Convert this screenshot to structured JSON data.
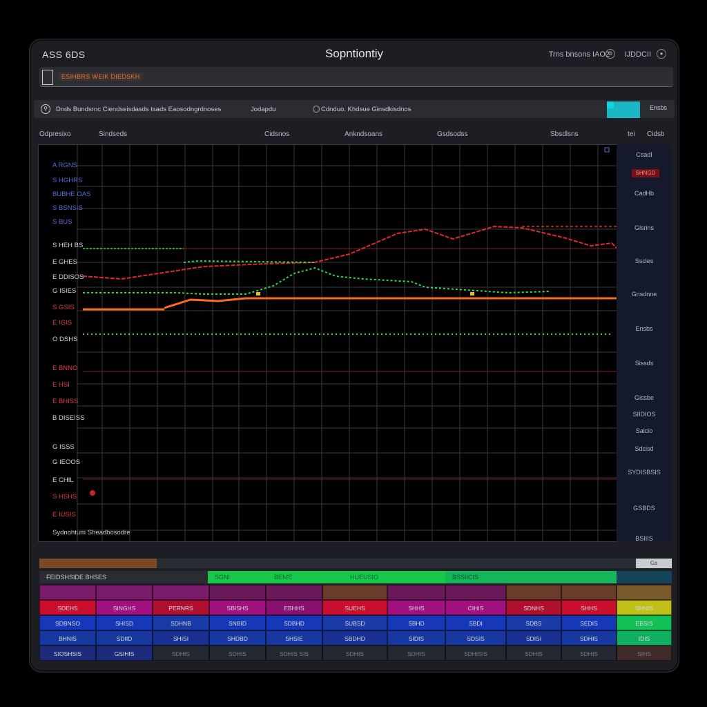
{
  "app": {
    "name": "ASS 6DS",
    "title": "Sopntiontiy"
  },
  "top_right": {
    "info": "Trns bnsons  IAO2",
    "user": "IJDDCII"
  },
  "alert": {
    "text": "ESIHBRS WEIK DIEDSKH",
    "color": "#e5703a"
  },
  "toolbar": {
    "left_text": "Dnds  Bundsrnc  Ciendseisdasds tsads  Eaosodngrdnoses",
    "mid_text": "Jodapdu",
    "radio_text": "Cdnduo.  Khdsue  Ginsdkisdnos",
    "end_label": "Ensbs"
  },
  "column_headers": [
    "Odpresixo",
    "Sindseds",
    "Cidsnos",
    "Ankndsoans",
    "Gsdsodss",
    "Sbsdlsns",
    "tei",
    "Cidsb"
  ],
  "chart": {
    "left_labels": [
      {
        "text": "A  RGNS",
        "color": "#5c6ad8"
      },
      {
        "text": "S HGHRS",
        "color": "#5c6ad8"
      },
      {
        "text": "BUBHE OAS",
        "color": "#5c6ad8"
      },
      {
        "text": "S BSNSIS",
        "color": "#5c6ad8"
      },
      {
        "text": "S BUS",
        "color": "#5c6ad8"
      },
      {
        "text": "S HEH BS",
        "color": "#d6d6dc"
      },
      {
        "text": "E GHES",
        "color": "#d6d6dc"
      },
      {
        "text": "E DDISOS",
        "color": "#d6d6dc"
      },
      {
        "text": "G ISIES",
        "color": "#d6d6dc"
      },
      {
        "text": "S GSIS",
        "color": "#d9434c"
      },
      {
        "text": "E IGIS",
        "color": "#d9434c"
      },
      {
        "text": "O DSHS",
        "color": "#d6d6dc"
      },
      {
        "text": "E BNNO",
        "color": "#e43b46"
      },
      {
        "text": "E HSI",
        "color": "#e43b46"
      },
      {
        "text": "E BHISS",
        "color": "#e43b46"
      },
      {
        "text": "B DISEISS",
        "color": "#d6d6dc"
      },
      {
        "text": "G ISSS",
        "color": "#d6d6dc"
      },
      {
        "text": "G IEOOS",
        "color": "#d6d6dc"
      },
      {
        "text": "E CHIL",
        "color": "#d6d6dc"
      },
      {
        "text": "S HSHS",
        "color": "#e43b46"
      },
      {
        "text": "E IUSIS",
        "color": "#e43b46"
      }
    ],
    "footer_label": "Sydnohtum  Sheadbosodre",
    "series": [
      {
        "color": "#e02a2a"
      },
      {
        "color": "#2fdc4a"
      },
      {
        "color": "#ff6a22"
      }
    ]
  },
  "right_panel": {
    "labels": [
      "CsadI",
      "CadHb",
      "Glsrins",
      "Sscles",
      "Gnsdnne",
      "Ensbs",
      "Sissds",
      "Gissbe",
      "SIIDIOS",
      "Salcio",
      "Sdcisd",
      "SYDISBSIS",
      "GSBDS",
      "BSIIIS"
    ],
    "badge": "SHNGD"
  },
  "bottom": {
    "button_label": "Gs",
    "tabs": [
      {
        "label": "FEIDSHSIDE  BHSES",
        "bg": "#2a2c31",
        "color": "#c9ccd4"
      },
      {
        "label": "SGNI",
        "bg": "#18c84a",
        "color": "#063"
      },
      {
        "label": "BEN'E",
        "bg": "#18c84a",
        "color": "#063"
      },
      {
        "label": "HUEUSIO",
        "bg": "#18c84a",
        "color": "#063"
      },
      {
        "label": "BSSIICIS",
        "bg": "#15b65a",
        "color": "#053"
      },
      {
        "label": "",
        "bg": "#15435a",
        "color": "#c9ccd4"
      }
    ],
    "rows": [
      {
        "cells": [
          {
            "t": "",
            "bg": "#7a1c6a"
          },
          {
            "t": "",
            "bg": "#7a1c6a"
          },
          {
            "t": "",
            "bg": "#7a1c6a"
          },
          {
            "t": "",
            "bg": "#6a1a5a"
          },
          {
            "t": "",
            "bg": "#6a1a5a"
          },
          {
            "t": "",
            "bg": "#6a3a2a"
          },
          {
            "t": "",
            "bg": "#6a1a5a"
          },
          {
            "t": "",
            "bg": "#6a1a5a"
          },
          {
            "t": "",
            "bg": "#6a3a2a"
          },
          {
            "t": "",
            "bg": "#6a3a2a"
          },
          {
            "t": "",
            "bg": "#7a5a2a"
          }
        ]
      },
      {
        "cells": [
          {
            "t": "SDEHS",
            "bg": "#c8102e"
          },
          {
            "t": "SINGHS",
            "bg": "#a0107e"
          },
          {
            "t": "PERNRS",
            "bg": "#b01030"
          },
          {
            "t": "SBISHS",
            "bg": "#a0107e"
          },
          {
            "t": "EBHHS",
            "bg": "#8a1070"
          },
          {
            "t": "SUEHS",
            "bg": "#c8102e"
          },
          {
            "t": "SHHS",
            "bg": "#a0107e"
          },
          {
            "t": "CIHIS",
            "bg": "#a0107e"
          },
          {
            "t": "SDNHS",
            "bg": "#b01030"
          },
          {
            "t": "SHHS",
            "bg": "#c8102e"
          },
          {
            "t": "SHNIS",
            "bg": "#c0c018"
          }
        ]
      },
      {
        "cells": [
          {
            "t": "SDBNSO",
            "bg": "#1638b8"
          },
          {
            "t": "SHISD",
            "bg": "#1638b8"
          },
          {
            "t": "SDHNB",
            "bg": "#1a3aa8"
          },
          {
            "t": "SNBID",
            "bg": "#1638b8"
          },
          {
            "t": "SDBHD",
            "bg": "#1638b8"
          },
          {
            "t": "SUBSD",
            "bg": "#1a3aa8"
          },
          {
            "t": "SBHD",
            "bg": "#1638b8"
          },
          {
            "t": "SBDI",
            "bg": "#1638b8"
          },
          {
            "t": "SDBS",
            "bg": "#1a3aa8"
          },
          {
            "t": "SEDIS",
            "bg": "#1638b8"
          },
          {
            "t": "EBSIS",
            "bg": "#14c058"
          }
        ]
      },
      {
        "cells": [
          {
            "t": "BHNIS",
            "bg": "#1838a0"
          },
          {
            "t": "SDIID",
            "bg": "#1838a0"
          },
          {
            "t": "SHISI",
            "bg": "#1a3090"
          },
          {
            "t": "SHDBD",
            "bg": "#1838a0"
          },
          {
            "t": "SHSIE",
            "bg": "#1838a0"
          },
          {
            "t": "SBDHD",
            "bg": "#1a3090"
          },
          {
            "t": "SIDIS",
            "bg": "#1838a0"
          },
          {
            "t": "SDSIS",
            "bg": "#1838a0"
          },
          {
            "t": "SDISI",
            "bg": "#1a3090"
          },
          {
            "t": "SDHIS",
            "bg": "#1838a0"
          },
          {
            "t": "IDIS",
            "bg": "#10b060"
          }
        ]
      },
      {
        "cells": [
          {
            "t": "SIOSHSIS",
            "bg": "#1c2c7a"
          },
          {
            "t": "GSIHIS",
            "bg": "#1c2c7a"
          },
          {
            "t": "SDHIS",
            "bg": "#242832"
          },
          {
            "t": "SDHIS",
            "bg": "#242832"
          },
          {
            "t": "SDHIS  SIS",
            "bg": "#242832"
          },
          {
            "t": "SDHIS",
            "bg": "#242832"
          },
          {
            "t": "SDHIS",
            "bg": "#242832"
          },
          {
            "t": "SDHISIS",
            "bg": "#242832"
          },
          {
            "t": "SDHIS",
            "bg": "#242832"
          },
          {
            "t": "SDHIS",
            "bg": "#242832"
          },
          {
            "t": "SIHS",
            "bg": "#402a2a"
          }
        ]
      }
    ]
  }
}
